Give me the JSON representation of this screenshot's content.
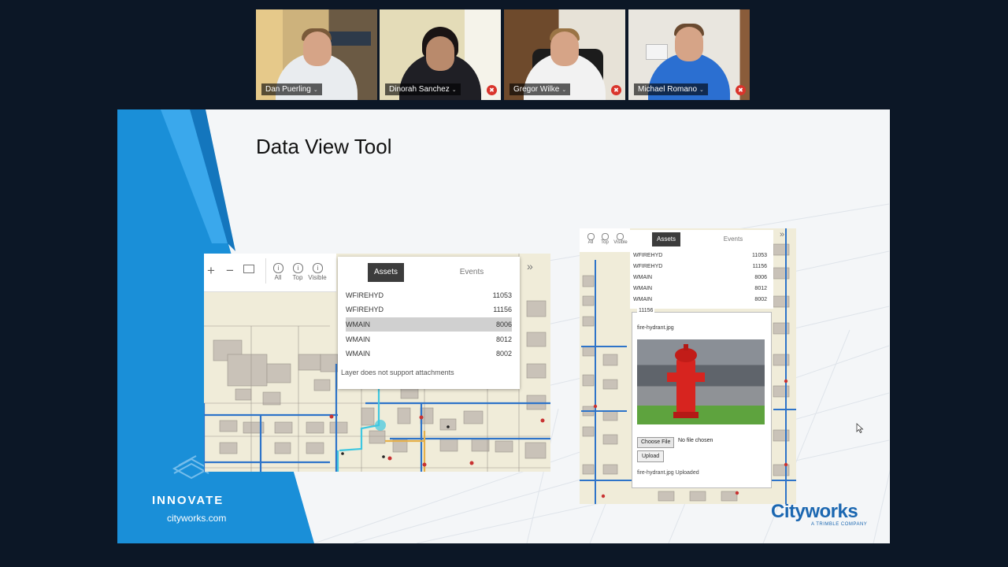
{
  "participants": [
    {
      "name": "Dan Puerling",
      "active": true,
      "muted": false
    },
    {
      "name": "Dinorah Sanchez",
      "active": false,
      "muted": true
    },
    {
      "name": "Gregor Wilke",
      "active": false,
      "muted": true
    },
    {
      "name": "Michael Romano",
      "active": false,
      "muted": true
    }
  ],
  "icons": {
    "mic_muted": "mic-muted-icon",
    "chevron": "chevron-down-icon",
    "expand": "double-chevron-icon",
    "info": "info-icon"
  },
  "slide": {
    "title": "Data View Tool",
    "brand_tagline": "INNOVATE",
    "brand_url": "cityworks.com",
    "logo": "Cityworks",
    "logo_sub": "A TRIMBLE COMPANY",
    "colors": {
      "accent": "#1a8fd8",
      "brand": "#1b67b1"
    }
  },
  "left_view": {
    "toolbar": {
      "zoom_in": "+",
      "zoom_out": "−",
      "all": "All",
      "top": "Top",
      "visible": "Visible"
    },
    "tabs": {
      "assets": "Assets",
      "events": "Events"
    },
    "rows": [
      {
        "layer": "WFIREHYD",
        "id": "11053"
      },
      {
        "layer": "WFIREHYD",
        "id": "11156"
      },
      {
        "layer": "WMAIN",
        "id": "8006"
      },
      {
        "layer": "WMAIN",
        "id": "8012"
      },
      {
        "layer": "WMAIN",
        "id": "8002"
      }
    ],
    "message": "Layer does not support attachments"
  },
  "right_view": {
    "toolbar": {
      "all": "All",
      "top": "Top",
      "visible": "Visible"
    },
    "tabs": {
      "assets": "Assets",
      "events": "Events"
    },
    "rows": [
      {
        "layer": "WFIREHYD",
        "id": "11053"
      },
      {
        "layer": "WFIREHYD",
        "id": "11156"
      },
      {
        "layer": "WMAIN",
        "id": "8006"
      },
      {
        "layer": "WMAIN",
        "id": "8012"
      },
      {
        "layer": "WMAIN",
        "id": "8002"
      }
    ],
    "attachment": {
      "group_label": "11156",
      "filename": "fire-hydrant.jpg",
      "choose_file": "Choose File",
      "no_file": "No file chosen",
      "upload": "Upload",
      "status": "fire-hydrant.jpg Uploaded"
    }
  }
}
